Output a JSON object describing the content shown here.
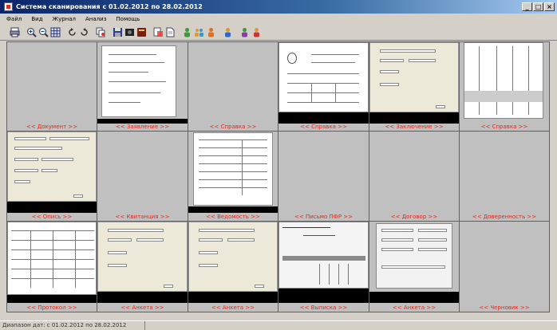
{
  "window": {
    "title": "Система сканирования с 01.02.2012 по 28.02.2012",
    "controls": {
      "minimize": "_",
      "maximize": "□",
      "close": "×"
    }
  },
  "menu": [
    "Файл",
    "Вид",
    "Журнал",
    "Анализ",
    "Помощь"
  ],
  "toolbar": {
    "icons": [
      "print-icon",
      "zoom-in-icon",
      "zoom-out-icon",
      "grid-view-icon",
      "rotate-left-icon",
      "rotate-right-icon",
      "copy-icon",
      "save-icon",
      "record-icon",
      "book-icon",
      "scan-icon",
      "page-icon",
      "person-green-icon",
      "person-multi-icon",
      "person-orange-icon",
      "person-blue-icon",
      "person-purple-icon",
      "person-red-icon"
    ]
  },
  "cells": [
    {
      "label": "<< Документ >>"
    },
    {
      "label": "<< Заявление >>"
    },
    {
      "label": "<< Справка >>"
    },
    {
      "label": "<< Справка >>"
    },
    {
      "label": "<< Заключение >>"
    },
    {
      "label": "<< Справка >>"
    },
    {
      "label": "<< Опись >>"
    },
    {
      "label": "<< Квитанция >>"
    },
    {
      "label": "<< Ведомость >>"
    },
    {
      "label": "<< Письмо ПФР >>"
    },
    {
      "label": "<< Договор >>"
    },
    {
      "label": "<< Доверенность >>"
    },
    {
      "label": "<< Протокол >>"
    },
    {
      "label": "<< Анкета >>"
    },
    {
      "label": "<< Анкета >>"
    },
    {
      "label": "<< Выписка >>"
    },
    {
      "label": "<< Анкета >>"
    },
    {
      "label": "<< Черновик >>"
    }
  ],
  "status": {
    "text": "Диапазон дат: с 01.02.2012 по 28.02.2012"
  }
}
